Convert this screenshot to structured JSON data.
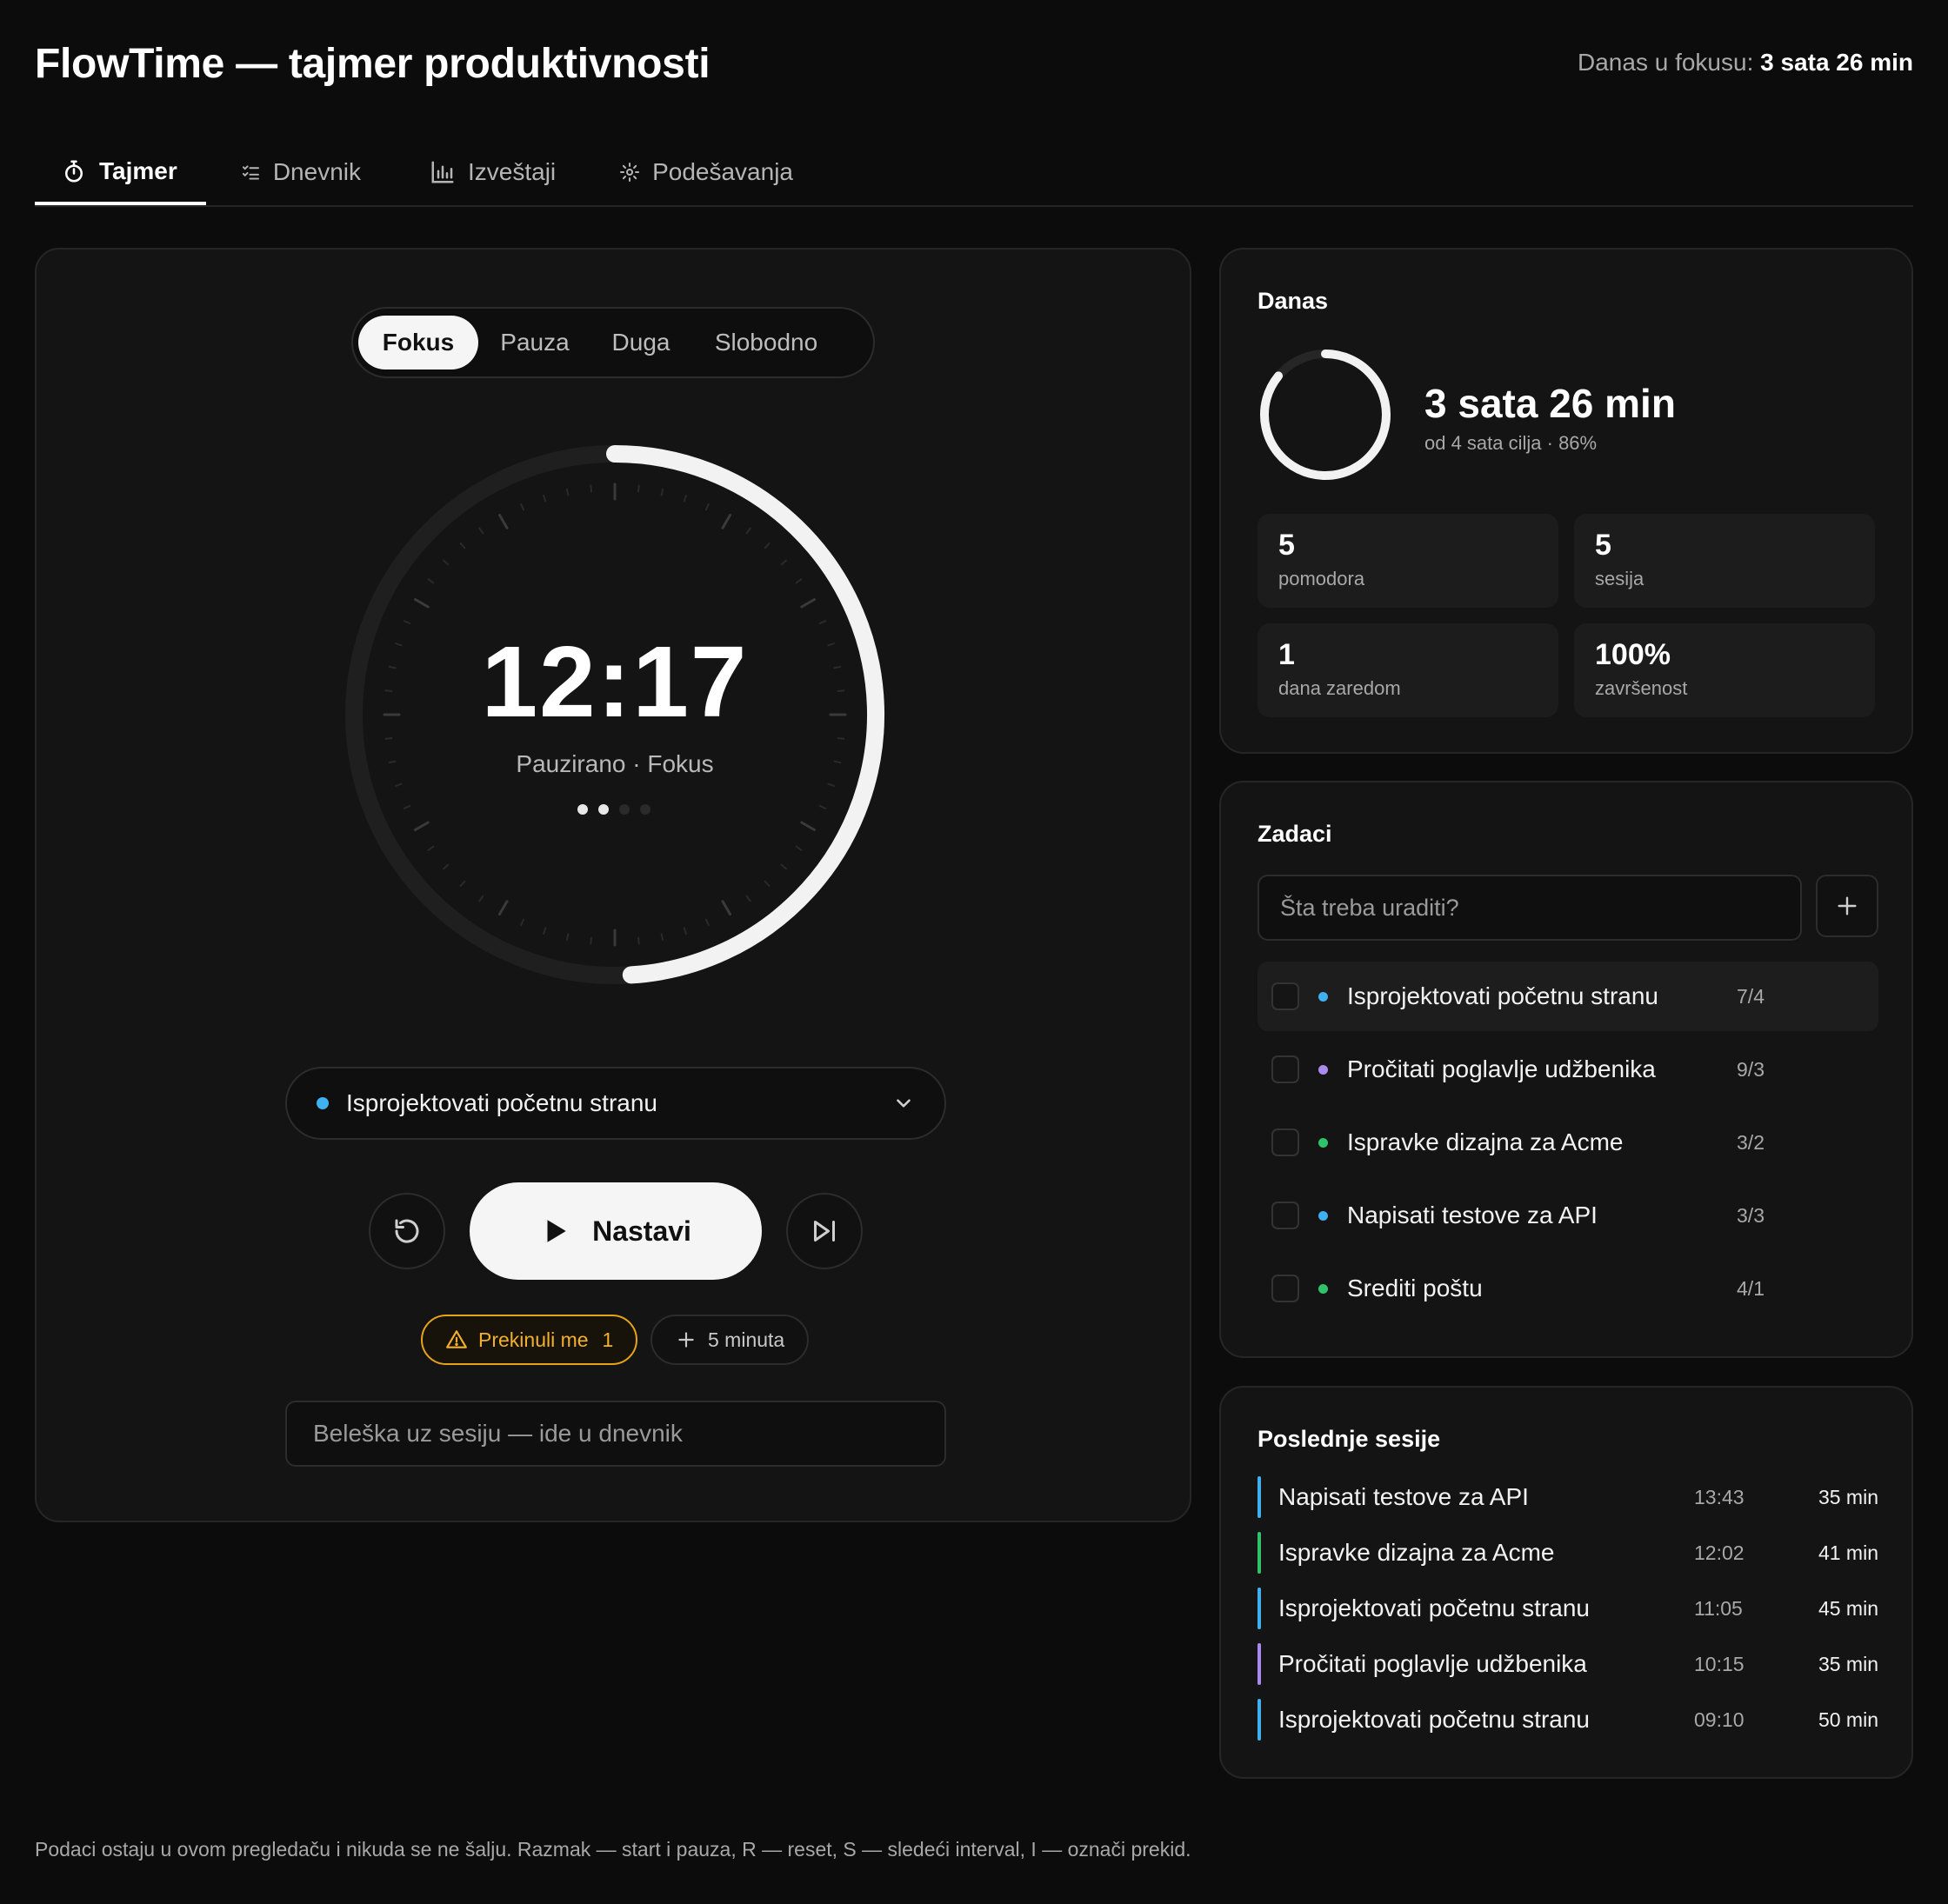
{
  "app": {
    "title": "FlowTime — tajmer produktivnosti",
    "today_label": "Danas u fokusu:",
    "today_value": "3 sata 26 min"
  },
  "nav": {
    "tabs": [
      {
        "label": "Tajmer",
        "icon": "stopwatch-icon",
        "active": true
      },
      {
        "label": "Dnevnik",
        "icon": "checklist-icon",
        "active": false
      },
      {
        "label": "Izveštaji",
        "icon": "bar-chart-icon",
        "active": false
      },
      {
        "label": "Podešavanja",
        "icon": "gear-icon",
        "active": false
      }
    ]
  },
  "timer": {
    "modes": [
      "Fokus",
      "Pauza",
      "Duga",
      "Slobodno"
    ],
    "active_mode": "Fokus",
    "time_display": "12:17",
    "state_text": "Pauzirano · Fokus",
    "remaining_fraction": 0.49,
    "cycle_dots": {
      "total": 4,
      "completed": 2
    },
    "current_task": "Isprojektovati početnu stranu",
    "current_task_color": "#3fb0f0",
    "primary_button": "Nastavi",
    "interrupt_label": "Prekinuli me",
    "interrupt_count": "1",
    "add_time_label": "5 minuta",
    "note_placeholder": "Beleška uz sesiju — ide u dnevnik"
  },
  "today": {
    "title": "Danas",
    "big_value": "3 sata 26 min",
    "goal_text": "od 4 sata cilja · 86%",
    "goal_fraction": 0.86,
    "stats": [
      {
        "value": "5",
        "label": "pomodora"
      },
      {
        "value": "5",
        "label": "sesija"
      },
      {
        "value": "1",
        "label": "dana zaredom"
      },
      {
        "value": "100%",
        "label": "završenost"
      }
    ]
  },
  "tasks": {
    "title": "Zadaci",
    "input_placeholder": "Šta treba uraditi?",
    "items": [
      {
        "name": "Isprojektovati početnu stranu",
        "count": "7/4",
        "color": "#3fb0f0",
        "selected": true
      },
      {
        "name": "Pročitati poglavlje udžbenika",
        "count": "9/3",
        "color": "#a98bf0",
        "selected": false
      },
      {
        "name": "Ispravke dizajna za Acme",
        "count": "3/2",
        "color": "#2fc26b",
        "selected": false
      },
      {
        "name": "Napisati testove za API",
        "count": "3/3",
        "color": "#3fb0f0",
        "selected": false
      },
      {
        "name": "Srediti poštu",
        "count": "4/1",
        "color": "#2fc26b",
        "selected": false
      }
    ]
  },
  "sessions": {
    "title": "Poslednje sesije",
    "items": [
      {
        "name": "Napisati testove za API",
        "time": "13:43",
        "duration": "35 min",
        "color": "#3fb0f0"
      },
      {
        "name": "Ispravke dizajna za Acme",
        "time": "12:02",
        "duration": "41 min",
        "color": "#2fc26b"
      },
      {
        "name": "Isprojektovati početnu stranu",
        "time": "11:05",
        "duration": "45 min",
        "color": "#3fb0f0"
      },
      {
        "name": "Pročitati poglavlje udžbenika",
        "time": "10:15",
        "duration": "35 min",
        "color": "#a98bf0"
      },
      {
        "name": "Isprojektovati početnu stranu",
        "time": "09:10",
        "duration": "50 min",
        "color": "#3fb0f0"
      }
    ]
  },
  "footer": {
    "text": "Podaci ostaju u ovom pregledaču i nikuda se ne šalju. Razmak — start i pauza, R — reset, S — sledeći interval, I — označi prekid."
  }
}
